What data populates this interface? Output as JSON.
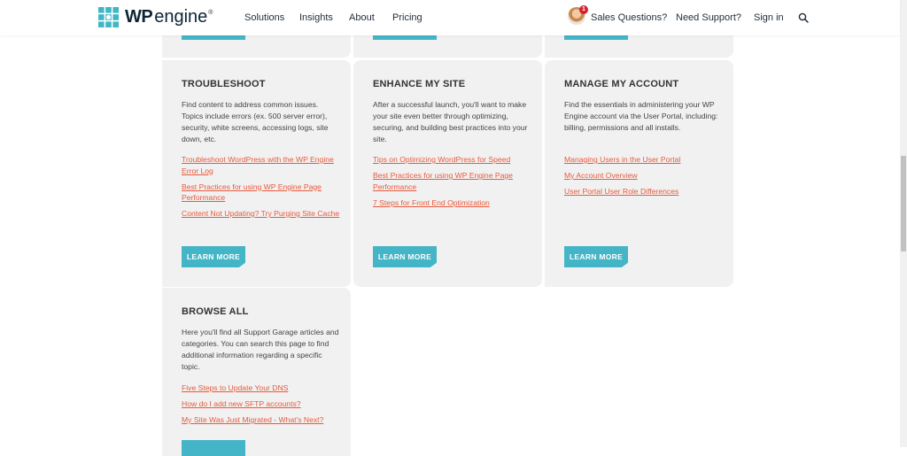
{
  "header": {
    "logo_wp": "WP",
    "logo_engine": "engine",
    "logo_reg": "®",
    "nav": [
      "Solutions",
      "Insights",
      "About",
      "Pricing"
    ],
    "sales": "Sales Questions?",
    "notification_count": "1",
    "support": "Need Support?",
    "signin": "Sign in"
  },
  "cards": [
    {
      "title": "TROUBLESHOOT",
      "description": "Find content to address common issues. Topics include errors (ex. 500 server error), security, white screens, accessing logs, site down, etc.",
      "links": [
        "Troubleshoot WordPress with the WP Engine Error Log",
        "Best Practices for using WP Engine Page Performance",
        "Content Not Updating? Try Purging Site Cache"
      ],
      "button": "LEARN MORE"
    },
    {
      "title": "ENHANCE MY SITE",
      "description": "After a successful launch, you'll want to make your site even better through optimizing, securing, and  building best practices into your site.",
      "links": [
        "Tips on Optimizing WordPress for Speed",
        "Best Practices for using WP Engine Page Performance",
        "7 Steps for Front End Optimization"
      ],
      "button": "LEARN MORE"
    },
    {
      "title": "MANAGE MY ACCOUNT",
      "description": "Find the essentials in administering your WP Engine account via the User Portal, including: billing, permissions and all installs.",
      "links": [
        "Managing Users in the User Portal",
        "My Account Overview",
        "User Portal User Role Differences"
      ],
      "button": "LEARN MORE"
    },
    {
      "title": "BROWSE ALL",
      "description": "Here you'll find all Support Garage articles and categories. You can search this page to find additional information regarding a specific topic.",
      "links": [
        "Five Steps to Update Your DNS",
        "How do I add new SFTP accounts?",
        "My Site Was Just Migrated - What's Next?"
      ]
    }
  ],
  "colors": {
    "accent": "#44b5c7",
    "link": "#e85a3c",
    "card_bg": "#f1f1f1",
    "brand": "#40b6c4"
  }
}
